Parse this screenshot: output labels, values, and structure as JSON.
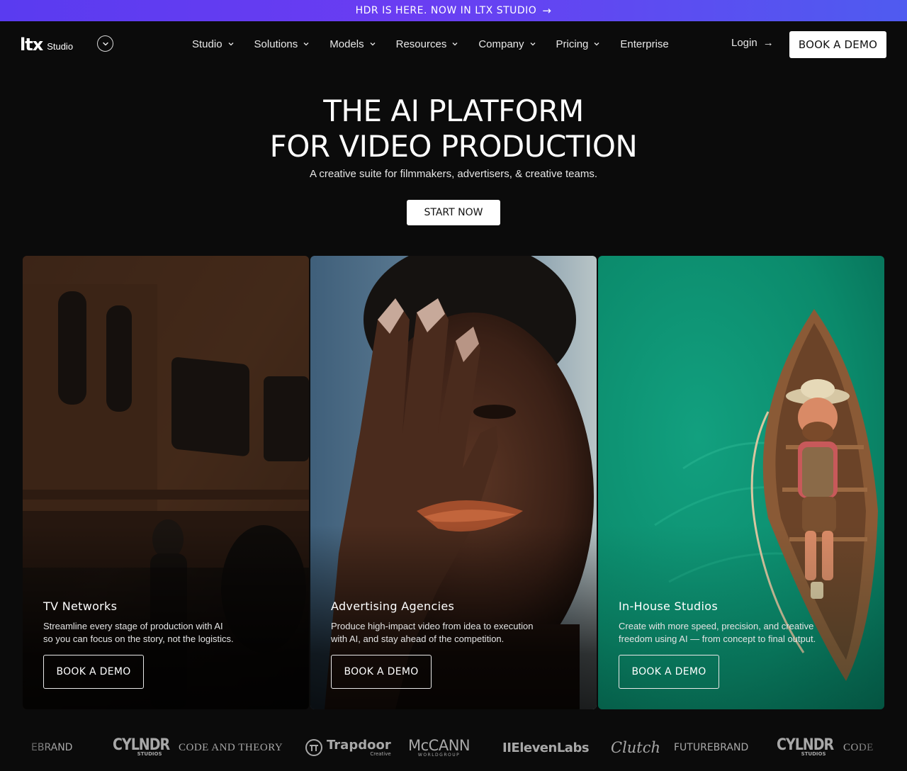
{
  "announcement": {
    "text": "HDR IS HERE. NOW IN LTX STUDIO"
  },
  "nav": {
    "logo_mark": "LTX",
    "logo_sub": "Studio",
    "items": [
      {
        "label": "Studio",
        "has_dropdown": true
      },
      {
        "label": "Solutions",
        "has_dropdown": true
      },
      {
        "label": "Models",
        "has_dropdown": true
      },
      {
        "label": "Resources",
        "has_dropdown": true
      },
      {
        "label": "Company",
        "has_dropdown": true
      },
      {
        "label": "Pricing",
        "has_dropdown": true
      },
      {
        "label": "Enterprise",
        "has_dropdown": false
      }
    ],
    "login_label": "Login",
    "book_demo_label": "BOOK A DEMO"
  },
  "hero": {
    "title_line1": "THE AI PLATFORM",
    "title_line2": "FOR VIDEO PRODUCTION",
    "subtitle": "A creative suite for filmmakers, advertisers, & creative teams.",
    "cta_label": "START NOW"
  },
  "cards": [
    {
      "title": "TV Networks",
      "desc_line1": "Streamline every stage of production with AI",
      "desc_line2": "so you can focus on the story, not the logistics.",
      "button_label": "BOOK A DEMO"
    },
    {
      "title": "Advertising Agencies",
      "desc_line1": "Produce high-impact video from idea to execution",
      "desc_line2": "with AI, and stay ahead of the competition.",
      "button_label": "BOOK A DEMO"
    },
    {
      "title": "In-House Studios",
      "desc_line1": "Create with more speed, precision, and creative",
      "desc_line2": "freedom using AI — from concept to final output.",
      "button_label": "BOOK A DEMO"
    }
  ],
  "client_logos": {
    "futurebrand_partial": "EBRAND",
    "cylndr": "CYLNDR",
    "cylndr_sub": "STUDIOS",
    "code_and_theory": "CODE AND THEORY",
    "trapdoor": "Trapdoor",
    "trapdoor_sub": "Creative",
    "mccann": "McCANN",
    "mccann_sub": "WORLDGROUP",
    "elevenlabs": "IIElevenLabs",
    "clutch": "Clutch",
    "futurebrand": "FUTUREBRAND",
    "cylndr_2": "CYLNDR",
    "cylndr_2_sub": "STUDIOS",
    "code_partial": "CODE"
  },
  "colors": {
    "background": "#0b0b0b",
    "announce_start": "#5a3bf0",
    "announce_end": "#4f5bf0",
    "teal_card": "#0d8a6c"
  }
}
